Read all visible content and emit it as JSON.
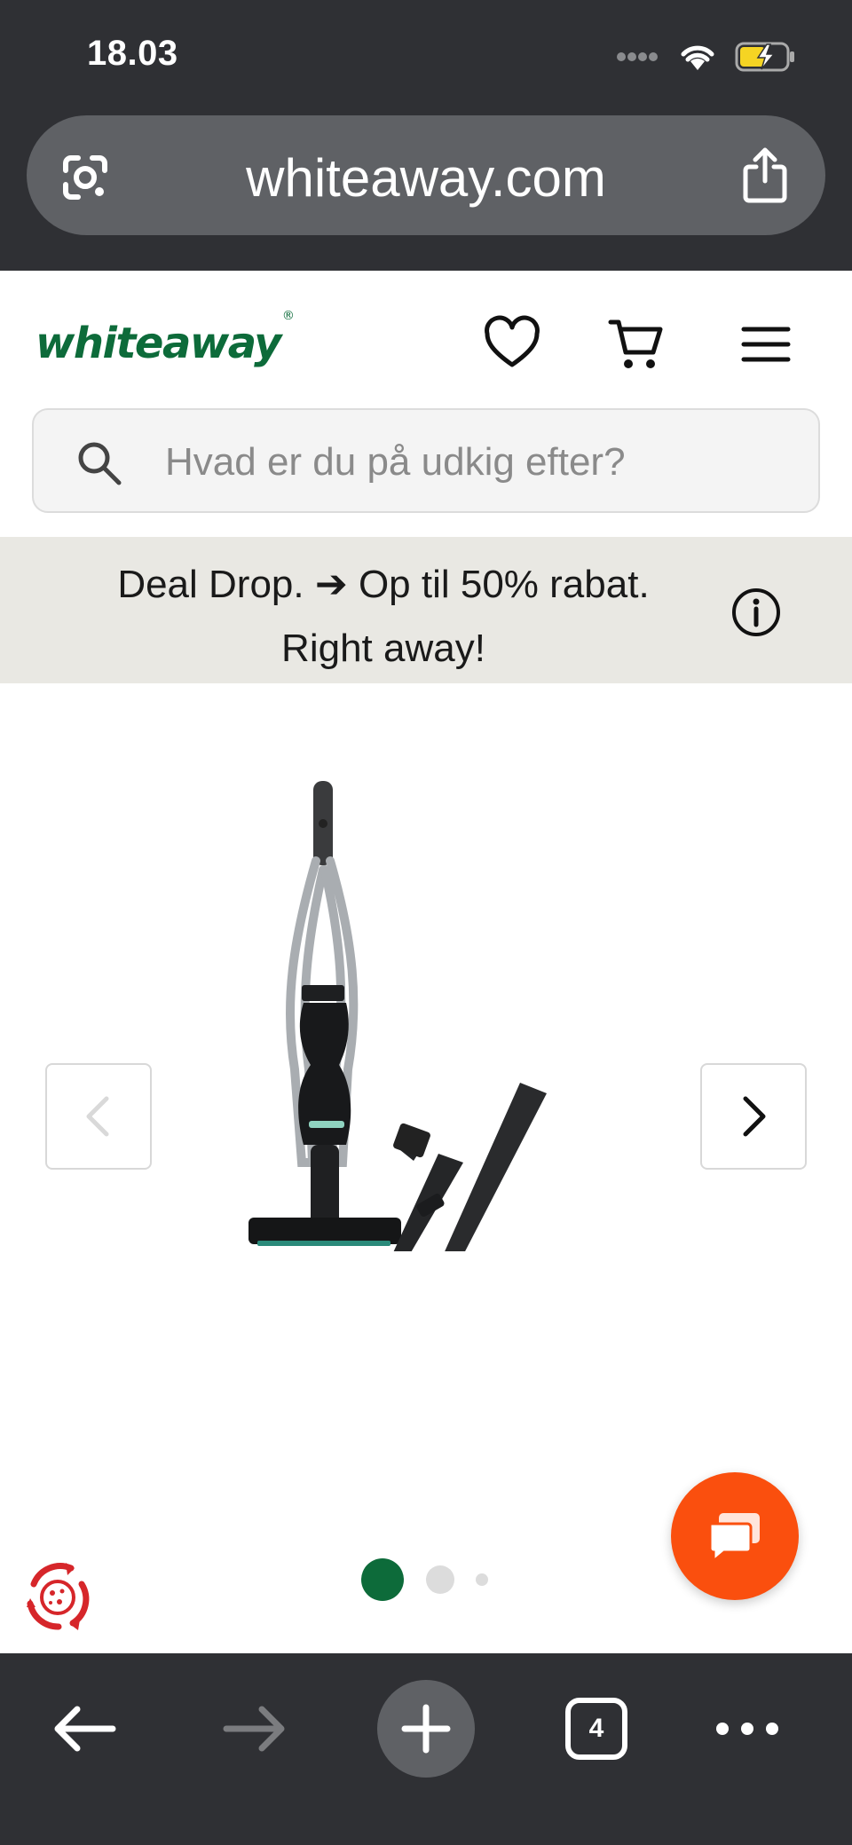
{
  "status_bar": {
    "time": "18.03"
  },
  "browser": {
    "url": "whiteaway.com",
    "tab_count": "4"
  },
  "header": {
    "logo_text": "whiteaway",
    "logo_mark": "®",
    "brand_color": "#0d6b3a"
  },
  "search": {
    "placeholder": "Hvad er du på udkig efter?"
  },
  "deal_banner": {
    "line1": "Deal Drop. ➔ Op til 50% rabat.",
    "line2": "Right away!"
  },
  "gallery": {
    "image_count": 3,
    "active_index": 0,
    "prev_disabled": true
  },
  "colors": {
    "chrome": "#2f3034",
    "chat_button": "#fa4f0e",
    "deal_bg": "#e9e8e3",
    "active_dot": "#0d6b3a"
  }
}
